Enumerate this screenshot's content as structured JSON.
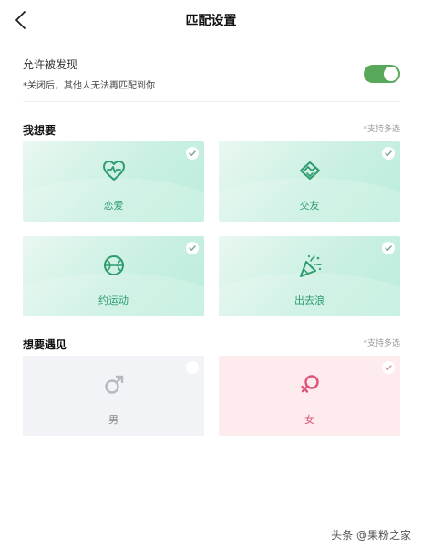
{
  "header": {
    "title": "匹配设置"
  },
  "discover": {
    "label": "允许被发现",
    "note": "*关闭后，其他人无法再匹配到你",
    "toggle_on": true,
    "toggle_color": "#58a85c"
  },
  "want": {
    "title": "我想要",
    "note": "*支持多选",
    "items": [
      {
        "label": "恋爱",
        "icon": "heart-pulse-icon",
        "selected": true
      },
      {
        "label": "交友",
        "icon": "handshake-icon",
        "selected": true
      },
      {
        "label": "约运动",
        "icon": "basketball-icon",
        "selected": true
      },
      {
        "label": "出去浪",
        "icon": "party-popper-icon",
        "selected": true
      }
    ]
  },
  "meet": {
    "title": "想要遇见",
    "note": "*支持多选",
    "items": [
      {
        "label": "男",
        "icon": "male-icon",
        "selected": false
      },
      {
        "label": "女",
        "icon": "female-icon",
        "selected": true
      }
    ]
  },
  "watermark": "头条 @果粉之家",
  "colors": {
    "accent_green": "#2e9d6e",
    "pink": "#e0527a",
    "card_green": "#c7efe1",
    "card_pink": "#fdebee",
    "card_grey": "#f2f3f7"
  }
}
